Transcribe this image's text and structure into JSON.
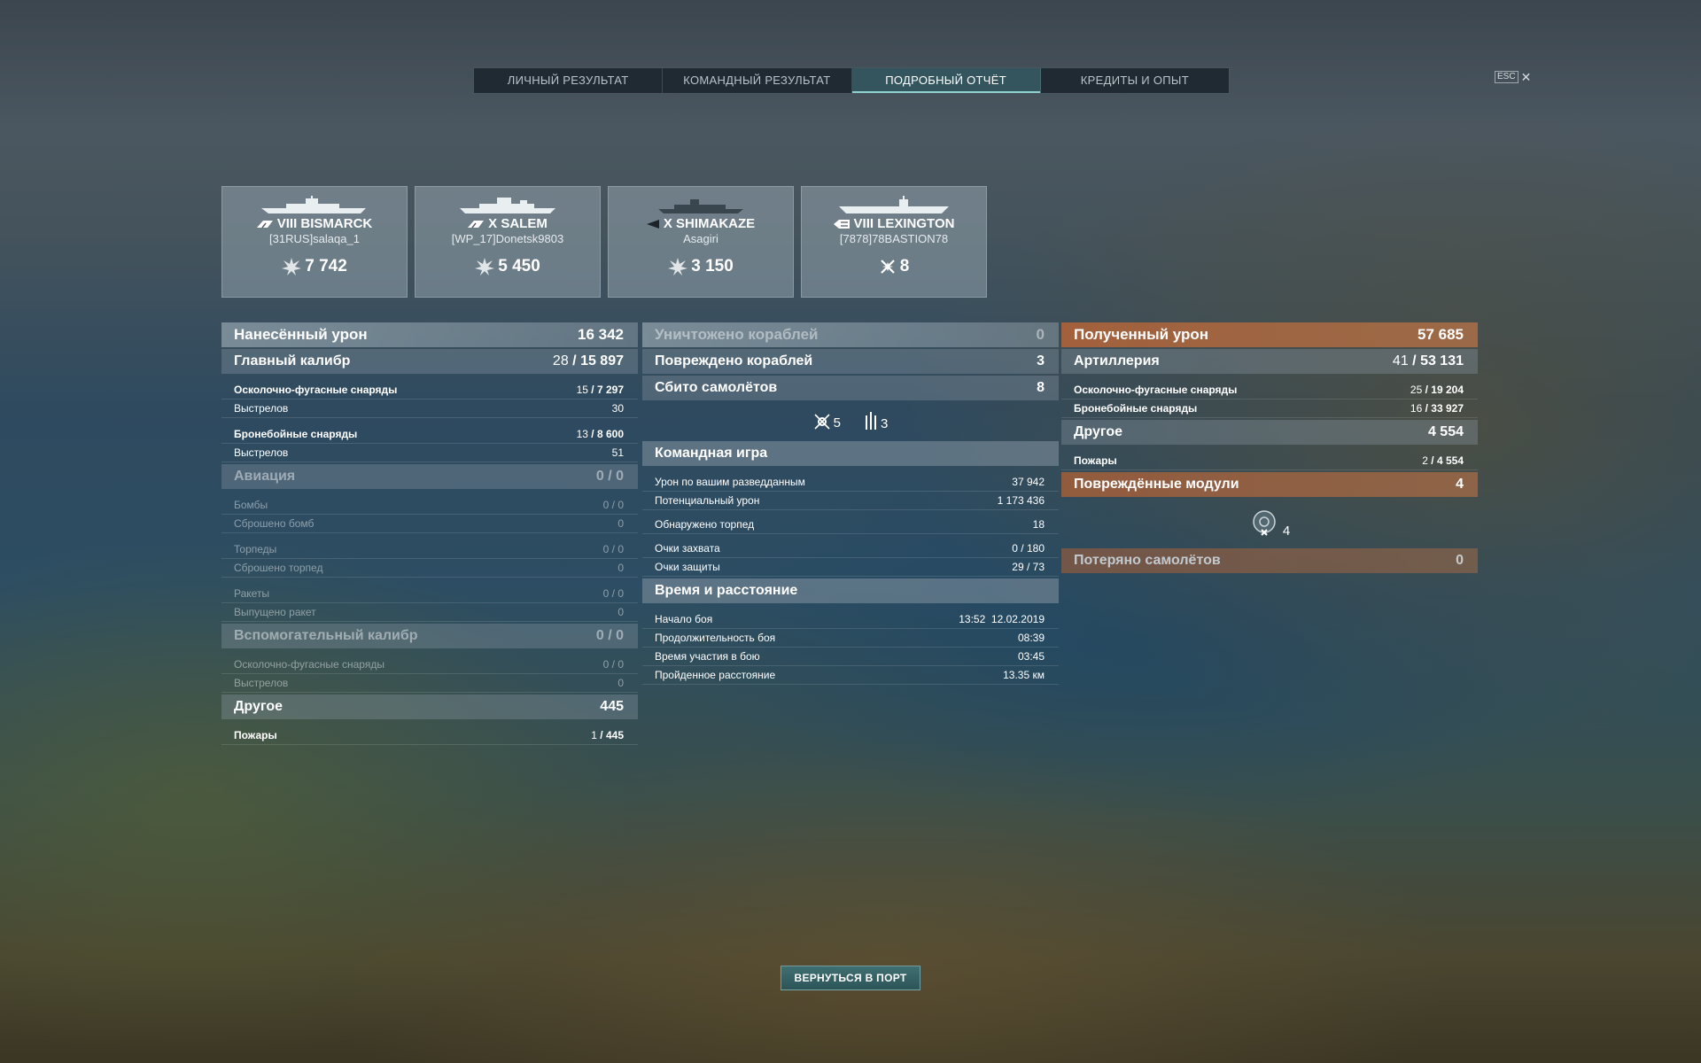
{
  "tabs": [
    {
      "label": "ЛИЧНЫЙ РЕЗУЛЬТАТ",
      "active": false
    },
    {
      "label": "КОМАНДНЫЙ РЕЗУЛЬТАТ",
      "active": false
    },
    {
      "label": "ПОДРОБНЫЙ ОТЧЁТ",
      "active": true
    },
    {
      "label": "КРЕДИТЫ И ОПЫТ",
      "active": false
    }
  ],
  "esc": {
    "key": "ESC",
    "close": "✕"
  },
  "ships": [
    {
      "class_icon": "battleship-class-icon",
      "name": "VIII BISMARCK",
      "player": "[31RUS]salaqa_1",
      "score_icon": "damage-icon",
      "score": "7 742"
    },
    {
      "class_icon": "cruiser-class-icon",
      "name": "X SALEM",
      "player": "[WP_17]Donetsk9803",
      "score_icon": "damage-icon",
      "score": "5 450"
    },
    {
      "class_icon": "destroyer-class-icon",
      "name": "X SHIMAKAZE",
      "player": "Asagiri",
      "score_icon": "damage-icon",
      "score": "3 150"
    },
    {
      "class_icon": "carrier-class-icon",
      "name": "VIII LEXINGTON",
      "player": "[7878]78BASTION78",
      "score_icon": "plane-shot-icon",
      "score": "8"
    }
  ],
  "left": {
    "dealt": {
      "label": "Нанесённый урон",
      "value": "16 342"
    },
    "main_battery": {
      "label": "Главный калибр",
      "hits": "28",
      "value": "15 897"
    },
    "mb_he": {
      "label": "Осколочно-фугасные снаряды",
      "hits": "15",
      "value": "7 297"
    },
    "mb_he_shots": {
      "label": "Выстрелов",
      "value": "30"
    },
    "mb_ap": {
      "label": "Бронебойные снаряды",
      "hits": "13",
      "value": "8 600"
    },
    "mb_ap_shots": {
      "label": "Выстрелов",
      "value": "51"
    },
    "aviation": {
      "label": "Авиация",
      "value": "0 / 0"
    },
    "bombs": {
      "label": "Бомбы",
      "value": "0 / 0"
    },
    "bombs_dropped": {
      "label": "Сброшено бомб",
      "value": "0"
    },
    "torpedoes": {
      "label": "Торпеды",
      "value": "0 / 0"
    },
    "torps_dropped": {
      "label": "Сброшено торпед",
      "value": "0"
    },
    "rockets": {
      "label": "Ракеты",
      "value": "0 / 0"
    },
    "rockets_fired": {
      "label": "Выпущено ракет",
      "value": "0"
    },
    "secondary": {
      "label": "Вспомогательный калибр",
      "value": "0 / 0"
    },
    "sec_he": {
      "label": "Осколочно-фугасные снаряды",
      "value": "0 / 0"
    },
    "sec_shots": {
      "label": "Выстрелов",
      "value": "0"
    },
    "other": {
      "label": "Другое",
      "value": "445"
    },
    "fires": {
      "label": "Пожары",
      "hits": "1",
      "value": "445"
    }
  },
  "middle": {
    "destroyed": {
      "label": "Уничтожено кораблей",
      "value": "0"
    },
    "damaged": {
      "label": "Повреждено кораблей",
      "value": "3"
    },
    "planes": {
      "label": "Сбито самолётов",
      "value": "8"
    },
    "icons": [
      {
        "icon": "flak-icon",
        "value": "5"
      },
      {
        "icon": "fighter-icon",
        "value": "3"
      }
    ],
    "team": {
      "label": "Командная игра"
    },
    "spotting_dmg": {
      "label": "Урон по вашим разведданным",
      "value": "37 942"
    },
    "potential_dmg": {
      "label": "Потенциальный урон",
      "value": "1 173 436"
    },
    "torps_spotted": {
      "label": "Обнаружено торпед",
      "value": "18"
    },
    "cap_pts": {
      "label": "Очки захвата",
      "value": "0 / 180"
    },
    "def_pts": {
      "label": "Очки защиты",
      "value": "29 / 73"
    },
    "time": {
      "label": "Время и расстояние"
    },
    "start": {
      "label": "Начало боя",
      "value": "13:52  12.02.2019"
    },
    "duration": {
      "label": "Продолжительность боя",
      "value": "08:39"
    },
    "time_in": {
      "label": "Время участия в бою",
      "value": "03:45"
    },
    "distance": {
      "label": "Пройденное расстояние",
      "value": "13.35 км"
    }
  },
  "right": {
    "received": {
      "label": "Полученный урон",
      "value": "57 685"
    },
    "artillery": {
      "label": "Артиллерия",
      "hits": "41",
      "value": "53 131"
    },
    "he": {
      "label": "Осколочно-фугасные снаряды",
      "hits": "25",
      "value": "19 204"
    },
    "ap": {
      "label": "Бронебойные снаряды",
      "hits": "16",
      "value": "33 927"
    },
    "other": {
      "label": "Другое",
      "value": "4 554"
    },
    "fires": {
      "label": "Пожары",
      "hits": "2",
      "value": "4 554"
    },
    "modules": {
      "label": "Повреждённые модули",
      "value": "4"
    },
    "module_icon": {
      "icon": "damaged-module-icon",
      "value": "4"
    },
    "planes_lost": {
      "label": "Потеряно самолётов",
      "value": "0"
    }
  },
  "return_button": "ВЕРНУТЬСЯ В ПОРТ",
  "colors": {
    "accent": "#8fd3d0",
    "received_header": "#c06a3c"
  }
}
